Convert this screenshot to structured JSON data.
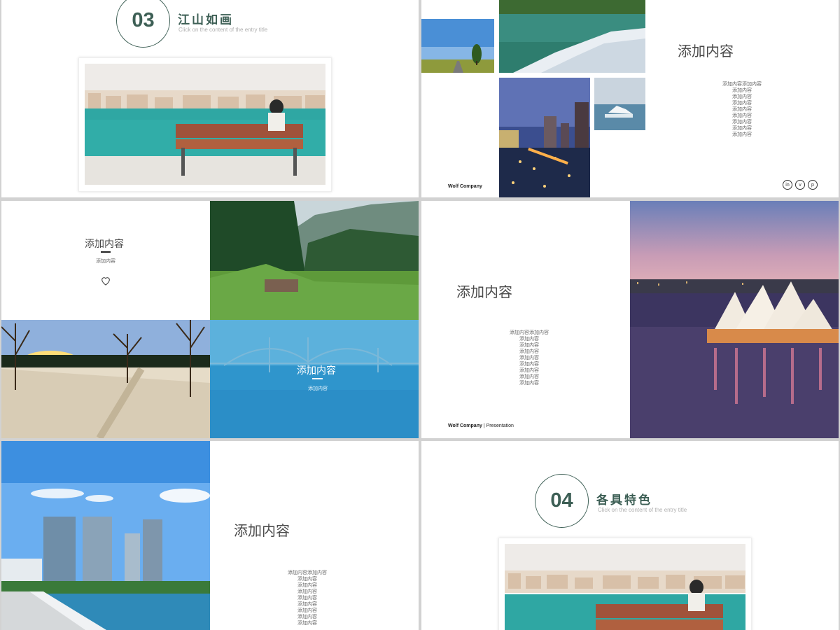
{
  "slide1": {
    "number": "03",
    "title": "江山如画",
    "subtitle": "Click on the content of the entry title"
  },
  "slide2": {
    "heading": "添加内容",
    "body": "添加内容添加内容\n添加内容\n添加内容\n添加内容\n添加内容\n添加内容\n添加内容\n添加内容\n添加内容",
    "company": "Wolf Company",
    "social": [
      "in",
      "v",
      "p"
    ]
  },
  "slide3": {
    "heading": "添加内容",
    "sub": "添加内容",
    "overlay_heading": "添加内容",
    "overlay_sub": "添加内容"
  },
  "slide4": {
    "heading": "添加内容",
    "body": "添加内容添加内容\n添加内容\n添加内容\n添加内容\n添加内容\n添加内容\n添加内容\n添加内容\n添加内容",
    "company": "Wolf Company",
    "company_suffix": " | Presentation"
  },
  "slide5": {
    "heading": "添加内容",
    "body": "添加内容添加内容\n添加内容\n添加内容\n添加内容\n添加内容\n添加内容\n添加内容\n添加内容\n添加内容"
  },
  "slide6": {
    "number": "04",
    "title": "各具特色",
    "subtitle": "Click on the content of the entry title"
  },
  "colors": {
    "accent": "#3d5f55",
    "background": "#d2d2d2"
  }
}
